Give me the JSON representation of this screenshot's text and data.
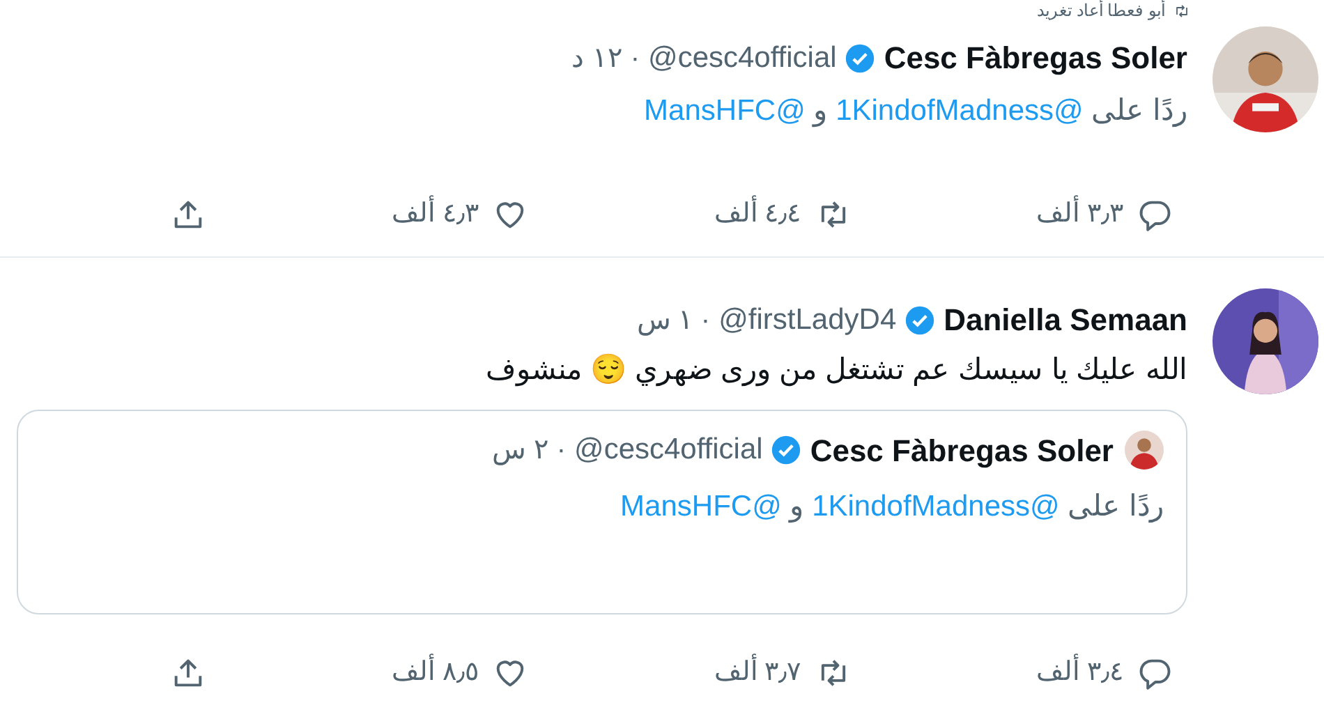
{
  "retweet_note": {
    "text": "أبو فعطا أعاد تغريد"
  },
  "tweets": [
    {
      "author": {
        "name": "Cesc Fàbregas Soler",
        "verified": true,
        "handle": "@cesc4official",
        "time": "· ١٢ د"
      },
      "reply_to": {
        "prefix": "ردًا على",
        "mentions": [
          "@1KindofMadness",
          "@MansHFC"
        ],
        "joiner": "و"
      },
      "actions": {
        "replies": "٣٫٣ ألف",
        "retweets": "٤٫٤ ألف",
        "likes": "٤٫٣ ألف"
      }
    },
    {
      "author": {
        "name": "Daniella Semaan",
        "verified": true,
        "handle": "@firstLadyD4",
        "time": "· ١ س"
      },
      "text": "الله عليك يا سيسك عم تشتغل من ورى ضهري 😌 منشوف",
      "quote": {
        "author": {
          "name": "Cesc Fàbregas Soler",
          "verified": true,
          "handle": "@cesc4official",
          "time": "· ٢ س"
        },
        "reply_to": {
          "prefix": "ردًا على",
          "mentions": [
            "@1KindofMadness",
            "@MansHFC"
          ],
          "joiner": "و"
        }
      },
      "actions": {
        "replies": "٣٫٤ ألف",
        "retweets": "٣٫٧ ألف",
        "likes": "٨٫٥ ألف"
      }
    }
  ]
}
